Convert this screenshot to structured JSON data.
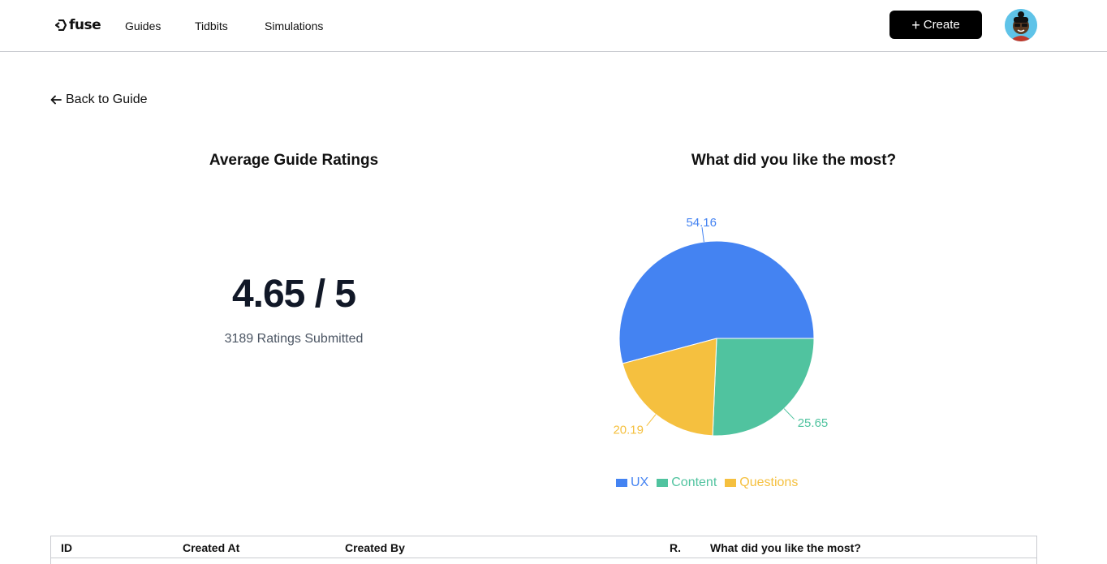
{
  "nav": {
    "logo_text": "fuse",
    "links": [
      "Guides",
      "Tidbits",
      "Simulations"
    ],
    "create_label": "Create"
  },
  "back_link": "Back to Guide",
  "ratings": {
    "title": "Average Guide Ratings",
    "average": "4.65 / 5",
    "submitted": "3189 Ratings Submitted"
  },
  "likes": {
    "title": "What did you like the most?"
  },
  "chart_data": {
    "type": "pie",
    "title": "What did you like the most?",
    "categories": [
      "UX",
      "Content",
      "Questions"
    ],
    "values": [
      54.16,
      25.65,
      20.19
    ],
    "colors": [
      "#4483f2",
      "#50c39f",
      "#f5c03f"
    ],
    "legend_position": "bottom"
  },
  "table": {
    "columns": [
      "ID",
      "Created At",
      "Created By",
      "R.",
      "What did you like the most?"
    ]
  }
}
